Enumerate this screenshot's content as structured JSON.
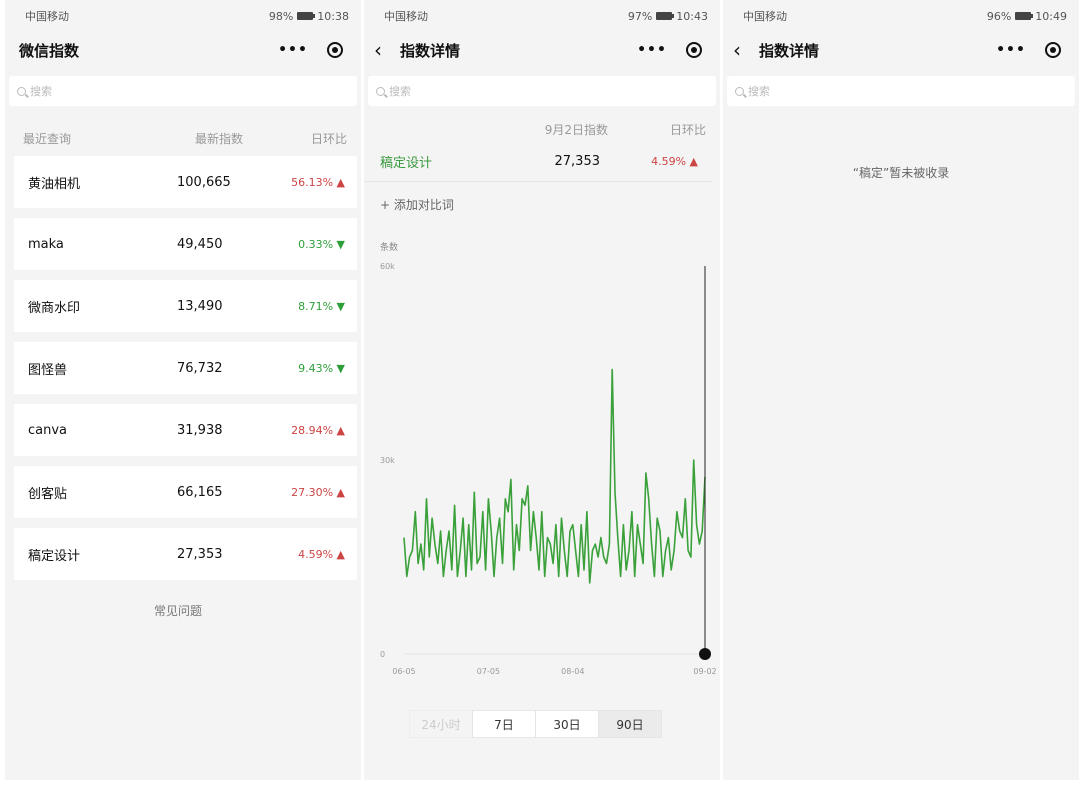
{
  "screens": [
    {
      "status": {
        "carrier": "中国移动",
        "battery_text": "98%",
        "time": "10:38"
      },
      "title": "微信指数",
      "search_placeholder": "搜索",
      "list_header": {
        "col1": "最近查询",
        "col2": "最新指数",
        "col3": "日环比"
      },
      "rows": [
        {
          "name": "黄油相机",
          "value": "100,665",
          "change": "56.13%",
          "dir": "up"
        },
        {
          "name": "maka",
          "value": "49,450",
          "change": "0.33%",
          "dir": "down"
        },
        {
          "name": "微商水印",
          "value": "13,490",
          "change": "8.71%",
          "dir": "down"
        },
        {
          "name": "图怪兽",
          "value": "76,732",
          "change": "9.43%",
          "dir": "down"
        },
        {
          "name": "canva",
          "value": "31,938",
          "change": "28.94%",
          "dir": "up"
        },
        {
          "name": "创客贴",
          "value": "66,165",
          "change": "27.30%",
          "dir": "up"
        },
        {
          "name": "稿定设计",
          "value": "27,353",
          "change": "4.59%",
          "dir": "up"
        }
      ],
      "faq": "常见问题"
    },
    {
      "status": {
        "carrier": "中国移动",
        "battery_text": "97%",
        "time": "10:43"
      },
      "title": "指数详情",
      "search_placeholder": "搜索",
      "header": {
        "col2": "9月2日指数",
        "col3": "日环比"
      },
      "row": {
        "name": "稿定设计",
        "value": "27,353",
        "change": "4.59%"
      },
      "add_compare": "+ 添加对比词",
      "range_tabs": [
        {
          "label": "24小时",
          "state": "disabled"
        },
        {
          "label": "7日",
          "state": "normal"
        },
        {
          "label": "30日",
          "state": "normal"
        },
        {
          "label": "90日",
          "state": "active"
        }
      ]
    },
    {
      "status": {
        "carrier": "中国移动",
        "battery_text": "96%",
        "time": "10:49"
      },
      "title": "指数详情",
      "search_placeholder": "搜索",
      "empty_message": "“稿定”暂未被收录"
    }
  ],
  "chart_data": {
    "type": "line",
    "title": "",
    "ylabel": "条数",
    "ylim": [
      0,
      60000
    ],
    "yticks": [
      "0",
      "30k",
      "60k"
    ],
    "xticks": [
      "06-05",
      "07-05",
      "08-04",
      "09-02"
    ],
    "line_color": "#3aa13a",
    "series": [
      {
        "values": [
          18000,
          12000,
          15000,
          16000,
          22000,
          14000,
          17000,
          13000,
          24000,
          15000,
          21000,
          17000,
          14000,
          19000,
          12000,
          16000,
          19000,
          13000,
          23000,
          12000,
          16000,
          21000,
          12000,
          20000,
          13000,
          25000,
          14000,
          15000,
          22000,
          13000,
          24000,
          19000,
          12000,
          18000,
          21000,
          14000,
          24000,
          22000,
          27000,
          13000,
          20000,
          16000,
          24000,
          23000,
          26000,
          16000,
          22000,
          18000,
          13000,
          22000,
          12000,
          18000,
          17000,
          14000,
          20000,
          12000,
          21000,
          16000,
          12000,
          19000,
          20000,
          16000,
          12000,
          20000,
          13000,
          22000,
          11000,
          16000,
          17000,
          15000,
          18000,
          15000,
          14000,
          17000,
          44000,
          25000,
          18000,
          12000,
          20000,
          13000,
          16000,
          22000,
          12000,
          20000,
          17000,
          14000,
          28000,
          24000,
          17000,
          12000,
          21000,
          19000,
          12000,
          16000,
          18000,
          13000,
          16000,
          22000,
          19000,
          18000,
          24000,
          16000,
          15000,
          30000,
          20000,
          17000,
          19000,
          27353
        ]
      }
    ]
  }
}
